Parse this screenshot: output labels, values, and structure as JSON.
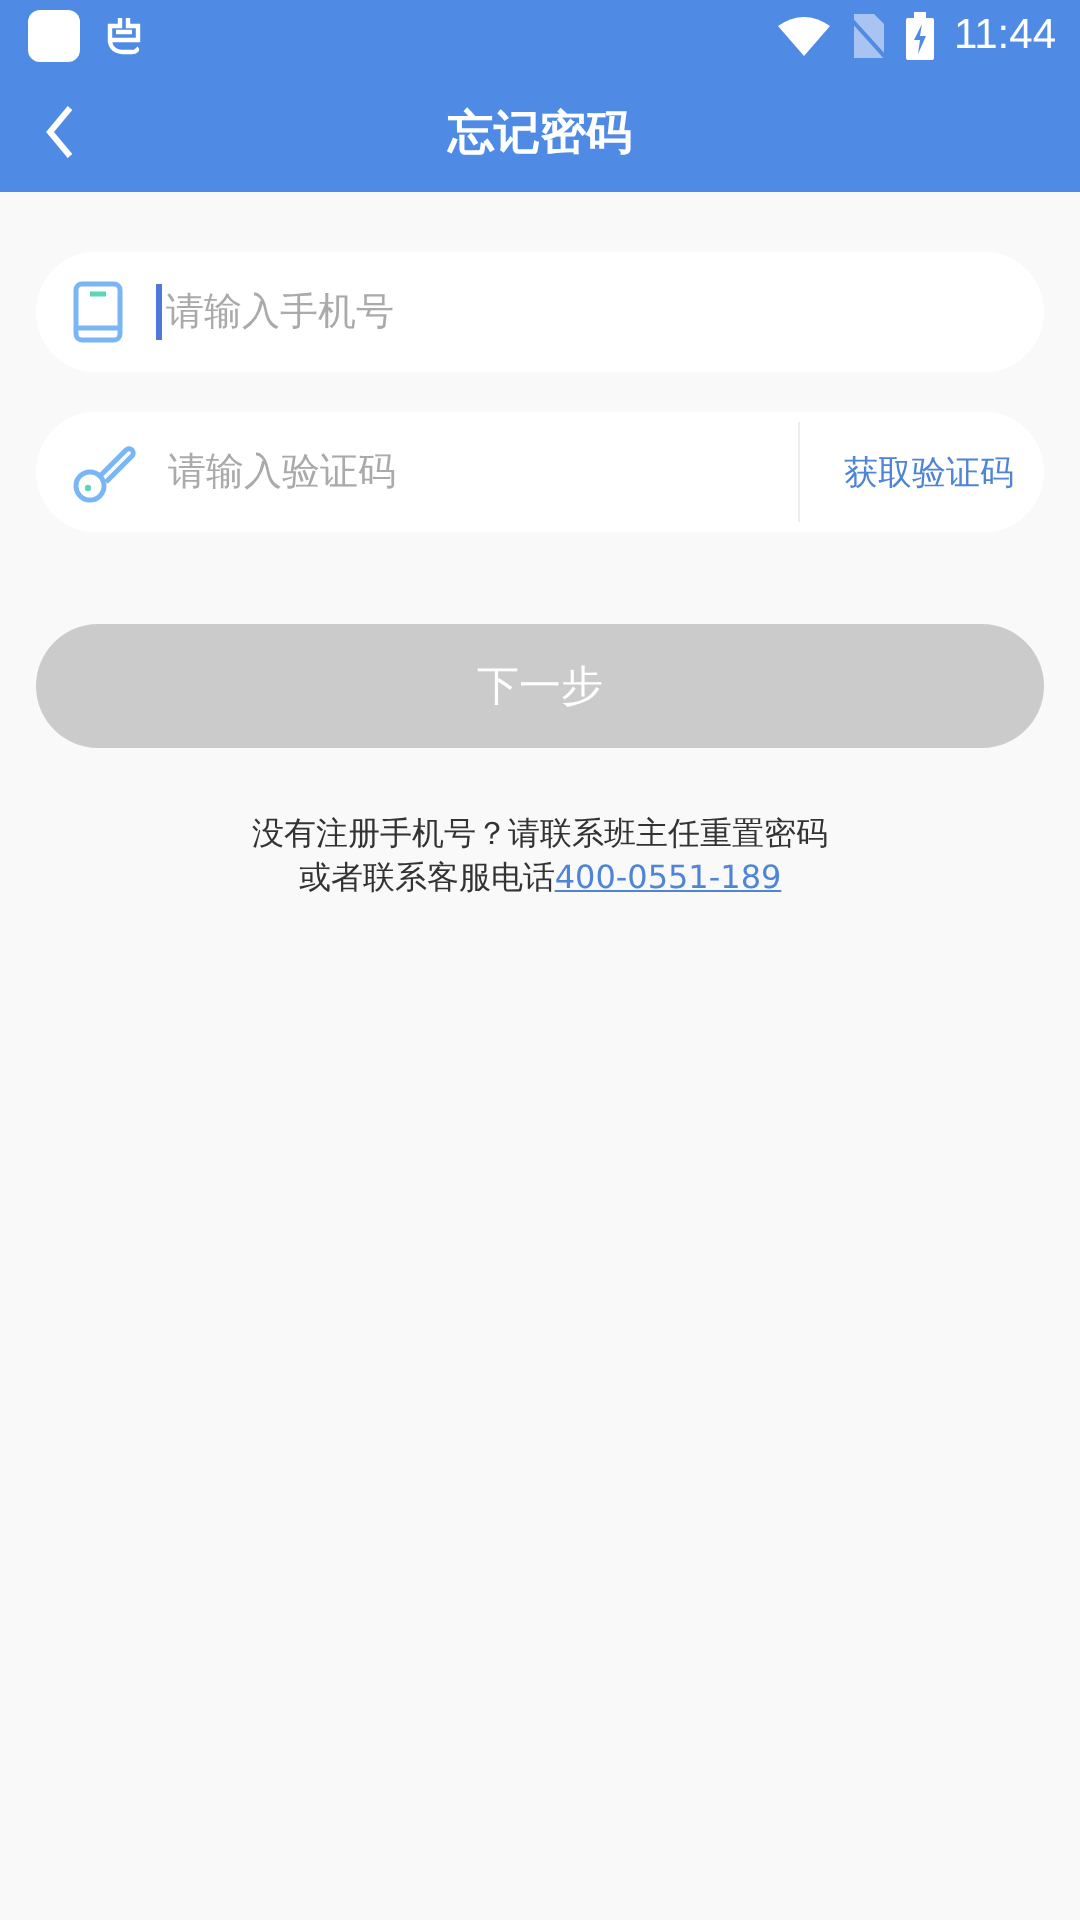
{
  "status_bar": {
    "time": "11:44"
  },
  "header": {
    "title": "忘记密码"
  },
  "phone_field": {
    "placeholder": "请输入手机号",
    "focused": true
  },
  "code_field": {
    "placeholder": "请输入验证码",
    "action": "获取验证码"
  },
  "next_button": {
    "label": "下一步",
    "disabled": true
  },
  "help": {
    "line_1": "没有注册手机号？请联系班主任重置密码",
    "line_2": "或者联系客服电话",
    "phone_link": "400-0551-189"
  }
}
